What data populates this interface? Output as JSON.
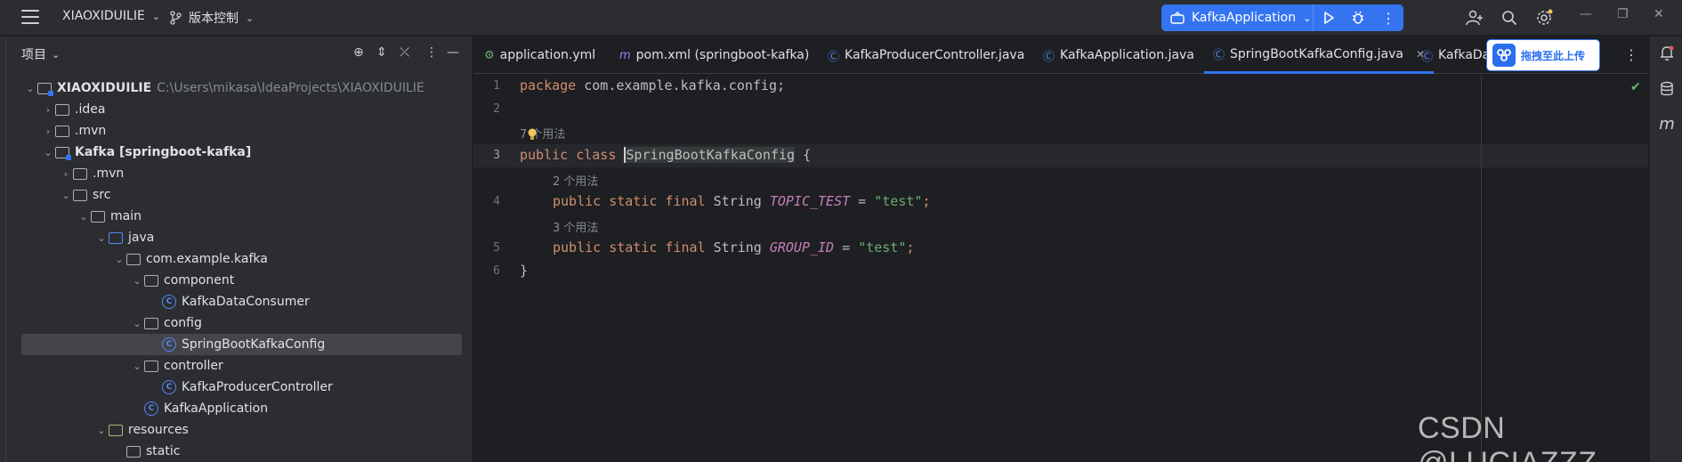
{
  "titlebar": {
    "project": "XIAOXIDUILIE",
    "vcs": "版本控制",
    "run_config": "KafkaApplication"
  },
  "project_panel": {
    "title": "项目",
    "tree": [
      {
        "label": "XIAOXIDUILIE",
        "extra": "C:\\Users\\mikasa\\IdeaProjects\\XIAOXIDUILIE",
        "depth": 0,
        "expanded": true,
        "icon": "module-folder"
      },
      {
        "label": ".idea",
        "depth": 1,
        "expanded": false,
        "icon": "folder"
      },
      {
        "label": ".mvn",
        "depth": 1,
        "expanded": false,
        "icon": "folder"
      },
      {
        "label": "Kafka [springboot-kafka]",
        "depth": 1,
        "expanded": true,
        "icon": "module-folder"
      },
      {
        "label": ".mvn",
        "depth": 2,
        "expanded": false,
        "icon": "folder"
      },
      {
        "label": "src",
        "depth": 2,
        "expanded": true,
        "icon": "folder"
      },
      {
        "label": "main",
        "depth": 3,
        "expanded": true,
        "icon": "folder"
      },
      {
        "label": "java",
        "depth": 4,
        "expanded": true,
        "icon": "source-folder"
      },
      {
        "label": "com.example.kafka",
        "depth": 5,
        "expanded": true,
        "icon": "package"
      },
      {
        "label": "component",
        "depth": 6,
        "expanded": true,
        "icon": "package"
      },
      {
        "label": "KafkaDataConsumer",
        "depth": 7,
        "icon": "class"
      },
      {
        "label": "config",
        "depth": 6,
        "expanded": true,
        "icon": "package"
      },
      {
        "label": "SpringBootKafkaConfig",
        "depth": 7,
        "icon": "class",
        "selected": true
      },
      {
        "label": "controller",
        "depth": 6,
        "expanded": true,
        "icon": "package"
      },
      {
        "label": "KafkaProducerController",
        "depth": 7,
        "icon": "class"
      },
      {
        "label": "KafkaApplication",
        "depth": 6,
        "icon": "spring-class"
      },
      {
        "label": "resources",
        "depth": 4,
        "expanded": true,
        "icon": "resources-folder"
      },
      {
        "label": "static",
        "depth": 5,
        "icon": "folder"
      }
    ]
  },
  "tabs": [
    {
      "label": "application.yml",
      "icon": "yml"
    },
    {
      "label": "pom.xml (springboot-kafka)",
      "icon": "maven"
    },
    {
      "label": "KafkaProducerController.java",
      "icon": "class"
    },
    {
      "label": "KafkaApplication.java",
      "icon": "spring-class"
    },
    {
      "label": "SpringBootKafkaConfig.java",
      "icon": "class",
      "active": true
    },
    {
      "label": "KafkaDat",
      "icon": "class"
    }
  ],
  "upload_badge": "拖拽至此上传",
  "editor": {
    "line_numbers": [
      "1",
      "2",
      "3",
      "4",
      "5",
      "6"
    ],
    "usage_hints": [
      "7 个用法",
      "2 个用法",
      "3 个用法"
    ],
    "line1": {
      "kw": "package",
      "rest": " com.example.kafka.config;"
    },
    "line3": {
      "kw1": "public",
      "kw2": "class",
      "name": "SpringBootKafkaConfig",
      "brace": " {"
    },
    "line4": {
      "kw": "public static final",
      "type": " String ",
      "name": "TOPIC_TEST",
      "eq": " = ",
      "value": "\"test\"",
      "semi": ";"
    },
    "line5": {
      "kw": "public static final",
      "type": " String ",
      "name": "GROUP_ID",
      "eq": " = ",
      "value": "\"test\"",
      "semi": ";"
    },
    "line6": "}"
  },
  "watermark": "CSDN @LUCIAZZZ"
}
